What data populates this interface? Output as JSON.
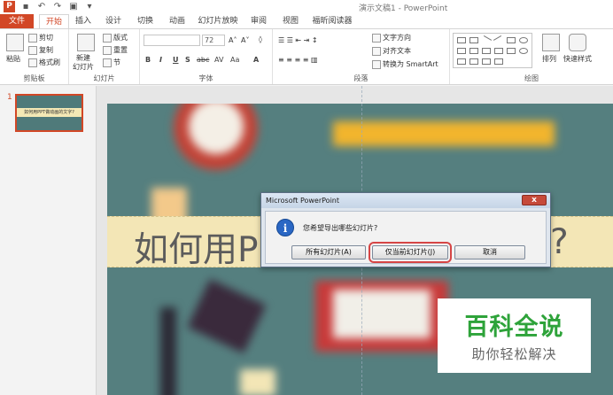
{
  "window": {
    "title": "演示文稿1 - PowerPoint",
    "logo": "P"
  },
  "tabs": [
    "文件",
    "开始",
    "插入",
    "设计",
    "切换",
    "动画",
    "幻灯片放映",
    "审阅",
    "视图",
    "福昕阅读器"
  ],
  "ribbon": {
    "clipboard": {
      "paste": "粘贴",
      "cut": "剪切",
      "copy": "复制",
      "format_painter": "格式刷",
      "label": "剪贴板"
    },
    "slides": {
      "new_slide_l1": "新建",
      "new_slide_l2": "幻灯片",
      "layout": "版式",
      "reset": "重置",
      "section": "节",
      "label": "幻灯片"
    },
    "font": {
      "size": "72",
      "bold": "B",
      "italic": "I",
      "underline": "U",
      "strike": "S",
      "abc": "abc",
      "spacing": "AV",
      "case": "Aa",
      "color": "A",
      "label": "字体"
    },
    "paragraph": {
      "text_direction": "文字方向",
      "align_text": "对齐文本",
      "smartart": "转换为 SmartArt",
      "label": "段落"
    },
    "drawing": {
      "arrange": "排列",
      "quick_styles": "快速样式",
      "label": "绘图"
    }
  },
  "thumbnail": {
    "number": "1",
    "caption": "如何用PPT做动画的文字?"
  },
  "slide": {
    "title_start": "如何用P",
    "title_end": "?"
  },
  "dialog": {
    "title": "Microsoft PowerPoint",
    "close": "x",
    "icon": "i",
    "message": "您希望导出哪些幻灯片?",
    "btn_all": "所有幻灯片(A)",
    "btn_current": "仅当前幻灯片(J)",
    "btn_cancel": "取消"
  },
  "watermark": {
    "main": "百科全说",
    "sub": "助你轻松解决"
  }
}
